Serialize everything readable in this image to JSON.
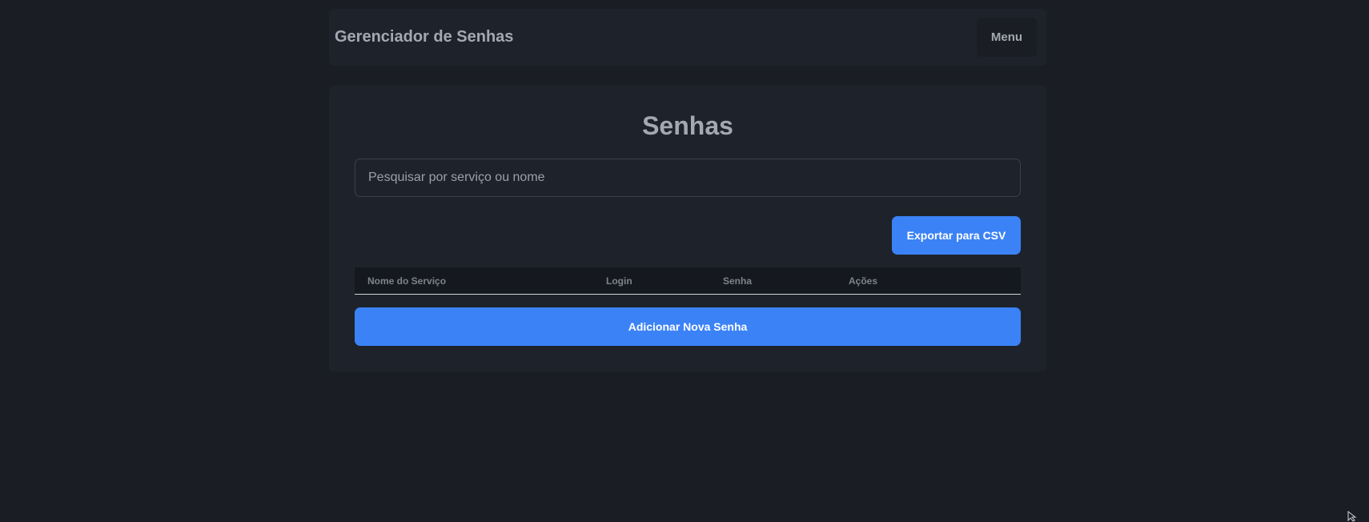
{
  "navbar": {
    "title": "Gerenciador de Senhas",
    "menu_label": "Menu"
  },
  "main": {
    "title": "Senhas",
    "search": {
      "placeholder": "Pesquisar por serviço ou nome",
      "value": ""
    },
    "export_label": "Exportar para CSV",
    "table": {
      "columns": [
        "Nome do Serviço",
        "Login",
        "Senha",
        "Ações"
      ],
      "rows": []
    },
    "add_label": "Adicionar Nova Senha"
  },
  "colors": {
    "background": "#1a1d24",
    "panel": "#1e232b",
    "accent": "#3b82f6"
  }
}
